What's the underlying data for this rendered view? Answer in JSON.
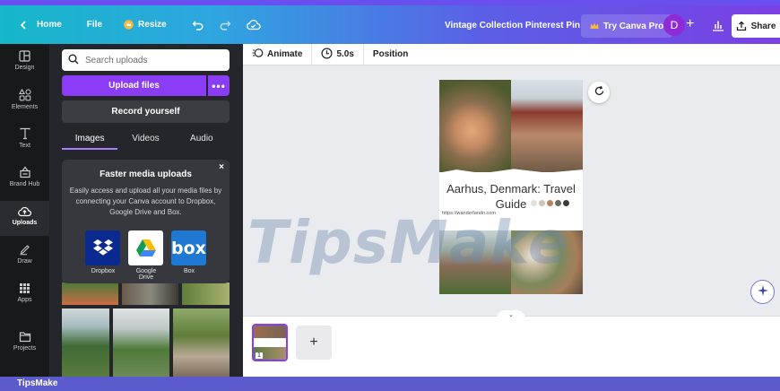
{
  "topbar": {
    "home_label": "Home",
    "file_label": "File",
    "resize_label": "Resize",
    "doc_title": "Vintage Collection Pinterest Pin",
    "try_pro_label": "Try Canva Pro",
    "avatar_initial": "D",
    "share_label": "Share"
  },
  "sidebar": {
    "items": [
      {
        "label": "Design",
        "icon": "layout-icon"
      },
      {
        "label": "Elements",
        "icon": "shapes-icon"
      },
      {
        "label": "Text",
        "icon": "text-icon"
      },
      {
        "label": "Brand Hub",
        "icon": "brand-icon"
      },
      {
        "label": "Uploads",
        "icon": "cloud-upload-icon"
      },
      {
        "label": "Draw",
        "icon": "pen-icon"
      },
      {
        "label": "Apps",
        "icon": "grid-icon"
      },
      {
        "label": "Projects",
        "icon": "folder-icon"
      }
    ],
    "active": "Uploads"
  },
  "uploads_panel": {
    "search_placeholder": "Search uploads",
    "upload_files_label": "Upload files",
    "more_label": "•••",
    "record_label": "Record yourself",
    "tabs": [
      {
        "label": "Images",
        "active": true
      },
      {
        "label": "Videos",
        "active": false
      },
      {
        "label": "Audio",
        "active": false
      }
    ],
    "popup": {
      "title": "Faster media uploads",
      "text": "Easily access and upload all your media files by connecting your Canva account to Dropbox, Google Drive and Box.",
      "close": "×",
      "services": [
        {
          "label": "Dropbox",
          "color": "#0b2a8f",
          "logo_text": ""
        },
        {
          "label": "Google Drive",
          "color": "#ffffff",
          "logo_text": ""
        },
        {
          "label": "Box",
          "color": "#1f78d1",
          "logo_text": "box"
        }
      ]
    }
  },
  "editor_toolbar": {
    "animate_label": "Animate",
    "duration_label": "5.0s",
    "position_label": "Position"
  },
  "canvas": {
    "pin_title": "Aarhus, Denmark: Travel Guide",
    "pin_url": "https://wanderlandn.com",
    "palette": [
      "#e3e0da",
      "#cfc4b8",
      "#b6835c",
      "#6b6a60",
      "#3b3b37"
    ]
  },
  "watermark": "TipsMake",
  "pages": {
    "page_number": "1",
    "add_label": "+",
    "collapse_label": "⌄"
  },
  "footer": {
    "label": "TipsMake"
  },
  "colors": {
    "accent": "#8b3df5",
    "sidebar_bg": "#18191b",
    "panel_bg": "#25262b"
  }
}
